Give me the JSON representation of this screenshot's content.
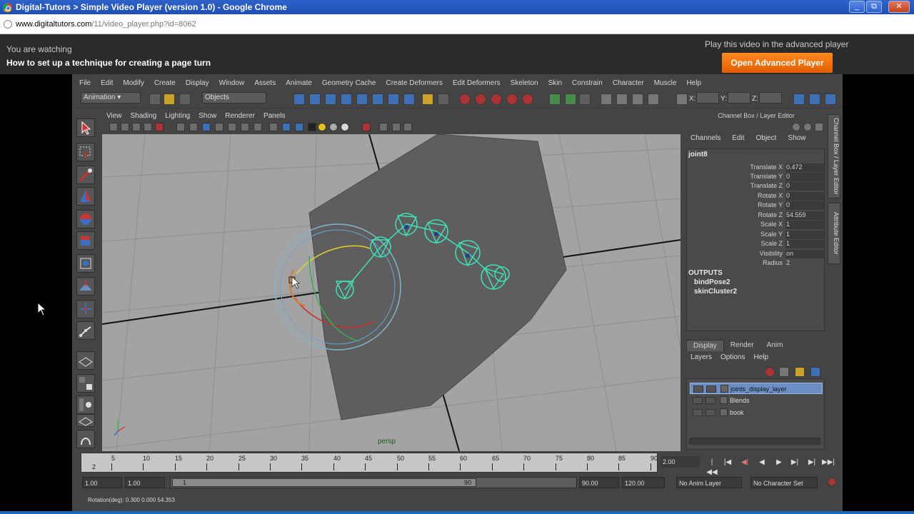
{
  "browser": {
    "title": "Digital-Tutors > Simple Video Player (version 1.0) - Google Chrome",
    "url_host": "www.digitaltutors.com",
    "url_path": "/11/video_player.php?id=8062",
    "buttons": [
      "_",
      "⧉",
      "✕"
    ]
  },
  "header": {
    "watching_label": "You are watching",
    "video_title": "How to set up a technique for creating a page turn",
    "advanced_label": "Play this video in the advanced player",
    "advanced_button": "Open Advanced Player",
    "accent_color": "#f07a12"
  },
  "maya": {
    "menus": [
      "File",
      "Edit",
      "Modify",
      "Create",
      "Display",
      "Window",
      "Assets",
      "Animate",
      "Geometry Cache",
      "Create Deformers",
      "Edit Deformers",
      "Skeleton",
      "Skin",
      "Constrain",
      "Character",
      "Muscle",
      "Help"
    ],
    "mode_dropdown": "Animation",
    "selection_field": "Objects",
    "coord_labels": [
      "X:",
      "Y:",
      "Z:"
    ],
    "panel_menus": [
      "View",
      "Shading",
      "Lighting",
      "Show",
      "Renderer",
      "Panels"
    ],
    "viewport_label": "persp",
    "channel_box": {
      "header": "Channel Box / Layer Editor",
      "menus": [
        "Channels",
        "Edit",
        "Object",
        "Show"
      ],
      "node": "joint8",
      "attributes": [
        {
          "label": "Translate X",
          "value": "0.472"
        },
        {
          "label": "Translate Y",
          "value": "0"
        },
        {
          "label": "Translate Z",
          "value": "0"
        },
        {
          "label": "Rotate X",
          "value": "0"
        },
        {
          "label": "Rotate Y",
          "value": "0"
        },
        {
          "label": "Rotate Z",
          "value": "54.559"
        },
        {
          "label": "Scale X",
          "value": "1"
        },
        {
          "label": "Scale Y",
          "value": "1"
        },
        {
          "label": "Scale Z",
          "value": "1"
        },
        {
          "label": "Visibility",
          "value": "on"
        },
        {
          "label": "Radius",
          "value": "2"
        }
      ],
      "outputs_heading": "OUTPUTS",
      "outputs": [
        "bindPose2",
        "skinCluster2"
      ]
    },
    "side_tabs": [
      "Channel Box / Layer Editor",
      "Attribute Editor"
    ],
    "layer_editor": {
      "tabs": [
        "Display",
        "Render",
        "Anim"
      ],
      "menus": [
        "Layers",
        "Options",
        "Help"
      ],
      "layers": [
        {
          "name": "joints_display_layer",
          "selected": true
        },
        {
          "name": "Blends",
          "selected": false
        },
        {
          "name": "book",
          "selected": false
        }
      ]
    },
    "timeline": {
      "ticks": [
        "2",
        "5",
        "10",
        "15",
        "20",
        "25",
        "30",
        "35",
        "40",
        "45",
        "50",
        "55",
        "60",
        "65",
        "70",
        "75",
        "80",
        "85",
        "90"
      ],
      "current_frame": "2.00",
      "playback_buttons": [
        "|◀◀",
        "|◀",
        "◀|",
        "◀",
        "▶",
        "▶|",
        "▶|",
        "▶▶|"
      ]
    },
    "range": {
      "start": "1.00",
      "start_inner": "1.00",
      "handle_start": "1",
      "handle_end": "90",
      "end_inner": "90.00",
      "end": "120.00",
      "anim_layer": "No Anim Layer",
      "char_set": "No Character Set"
    },
    "command_line": "Rotation(deg):      0.300       0.000       54.353"
  }
}
